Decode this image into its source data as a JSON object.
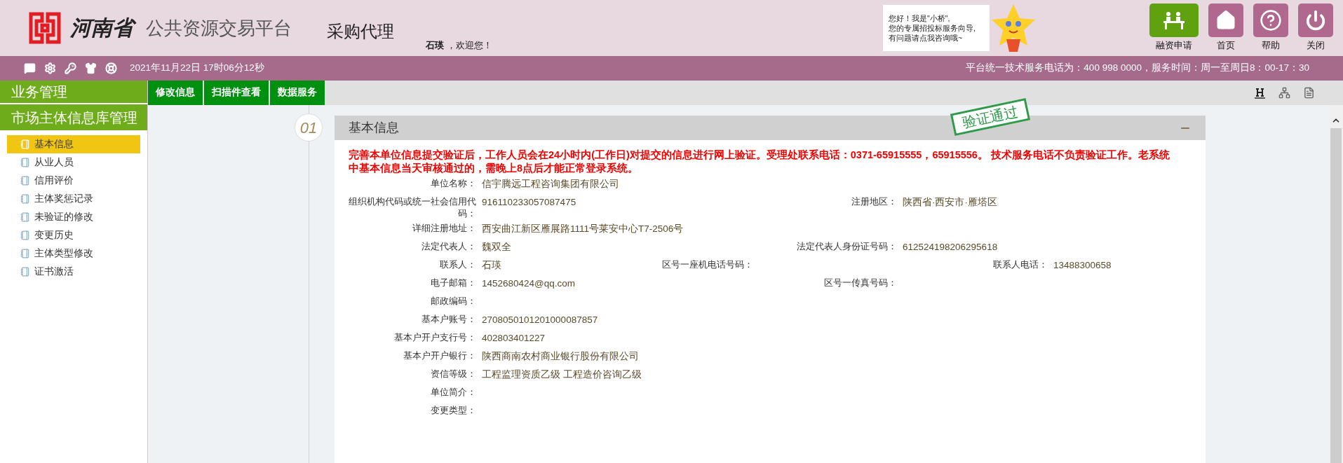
{
  "header": {
    "province": "河南省",
    "platform": "公共资源交易平台",
    "module": "采购代理",
    "user": "石瑛",
    "welcome": "，欢迎您！",
    "assistant": [
      "您好！我是\"小桥\",",
      "您的专属招投标服务向导,",
      "有问题请点我咨询哦~"
    ],
    "tiles": [
      {
        "label": "融资申请",
        "kind": "finance"
      },
      {
        "label": "首页",
        "kind": "home"
      },
      {
        "label": "帮助",
        "kind": "help"
      },
      {
        "label": "关闭",
        "kind": "power"
      }
    ]
  },
  "infobar": {
    "datetime": "2021年11月22日 17时06分12秒",
    "service": "平台统一技术服务电话为：400 998 0000，服务时间：周一至周日8：00-17：30"
  },
  "sidebar": {
    "section": "业务管理",
    "group": "市场主体信息库管理",
    "items": [
      {
        "label": "基本信息",
        "selected": true
      },
      {
        "label": "从业人员",
        "selected": false
      },
      {
        "label": "信用评价",
        "selected": false
      },
      {
        "label": "主体奖惩记录",
        "selected": false
      },
      {
        "label": "未验证的修改",
        "selected": false
      },
      {
        "label": "变更历史",
        "selected": false
      },
      {
        "label": "主体类型修改",
        "selected": false
      },
      {
        "label": "证书激活",
        "selected": false
      }
    ]
  },
  "tabs": [
    {
      "label": "修改信息"
    },
    {
      "label": "扫描件查看"
    },
    {
      "label": "数据服务"
    }
  ],
  "panel": {
    "step": "01",
    "title": "基本信息",
    "stamp": "验证通过",
    "notice": "完善本单位信息提交验证后，工作人员会在24小时内(工作日)对提交的信息进行网上验证。受理处联系电话：0371-65915555，65915556。 技术服务电话不负责验证工作。老系统中基本信息当天审核通过的，需晚上8点后才能正常登录系统。",
    "rows": [
      [
        {
          "label": "单位名称：",
          "value": "信宇腾远工程咨询集团有限公司"
        }
      ],
      [
        {
          "label": "组织机构代码或统一社会信用代码：",
          "value": "916110233057087475"
        },
        {
          "label": "注册地区：",
          "value": "陕西省·西安市·雁塔区"
        }
      ],
      [
        {
          "label": "详细注册地址：",
          "value": "西安曲江新区雁展路1111号莱安中心T7-2506号"
        }
      ],
      [
        {
          "label": "法定代表人：",
          "value": "魏双全"
        },
        {
          "label": "法定代表人身份证号码：",
          "value": "612524198206295618"
        }
      ],
      [
        {
          "label": "联系人：",
          "value": "石瑛"
        },
        {
          "label": "区号一座机电话号码："
        },
        {
          "label": "联系人电话：",
          "value": "13488300658"
        }
      ],
      [
        {
          "label": "电子邮箱：",
          "value": "1452680424@qq.com"
        },
        {
          "label": "区号一传真号码："
        }
      ],
      [
        {
          "label": "邮政编码："
        }
      ],
      [
        {
          "label": "基本户账号：",
          "value": "2708050101201000087857"
        }
      ],
      [
        {
          "label": "基本户开户支行号：",
          "value": "402803401227"
        }
      ],
      [
        {
          "label": "基本户开户银行：",
          "value": "陕西商南农村商业银行股份有限公司"
        }
      ],
      [
        {
          "label": "资信等级：",
          "value": "工程监理资质乙级 工程造价咨询乙级"
        }
      ],
      [
        {
          "label": "单位简介："
        }
      ],
      [
        {
          "label": "变更类型："
        }
      ]
    ]
  }
}
